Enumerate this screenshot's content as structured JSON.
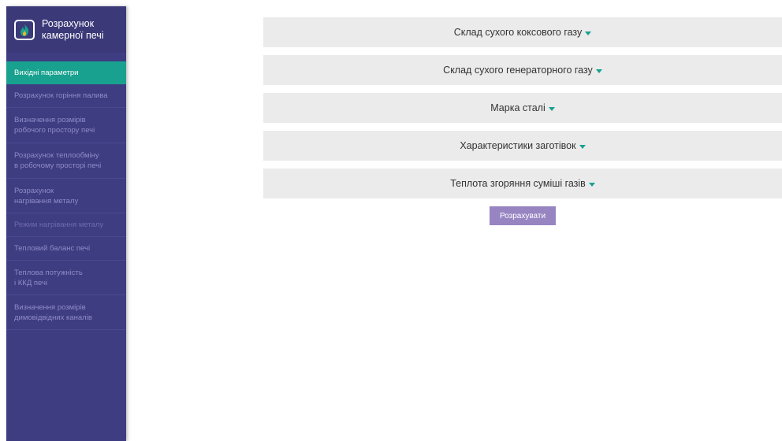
{
  "app": {
    "title": "Розрахунок\nкамерної печі"
  },
  "sidebar": {
    "items": [
      {
        "label": "Вихідні параметри",
        "active": true
      },
      {
        "label": "Розрахунок горіння палива"
      },
      {
        "label": "Визначення розмірів\nробочого простору печі"
      },
      {
        "label": "Розрахунок теплообміну\nв робочому просторі печі"
      },
      {
        "label": "Розрахунок\nнагрівання металу"
      },
      {
        "label": "Режим нагрівання металу"
      },
      {
        "label": "Тепловий баланс печі"
      },
      {
        "label": "Теплова потужність\nі ККД печі"
      },
      {
        "label": "Визначення розмірів\nдимовідвідних каналів"
      }
    ]
  },
  "main": {
    "sections": [
      {
        "label": "Склад сухого коксового газу"
      },
      {
        "label": "Склад сухого генераторного газу"
      },
      {
        "label": "Марка сталі"
      },
      {
        "label": "Характеристики заготівок"
      },
      {
        "label": "Теплота згоряння суміші газів"
      }
    ],
    "calculate_label": "Розрахувати"
  },
  "colors": {
    "sidebar_bg": "#3f3d82",
    "active_item": "#18a18f",
    "button": "#9785c2",
    "section_bg": "#ebebeb"
  }
}
